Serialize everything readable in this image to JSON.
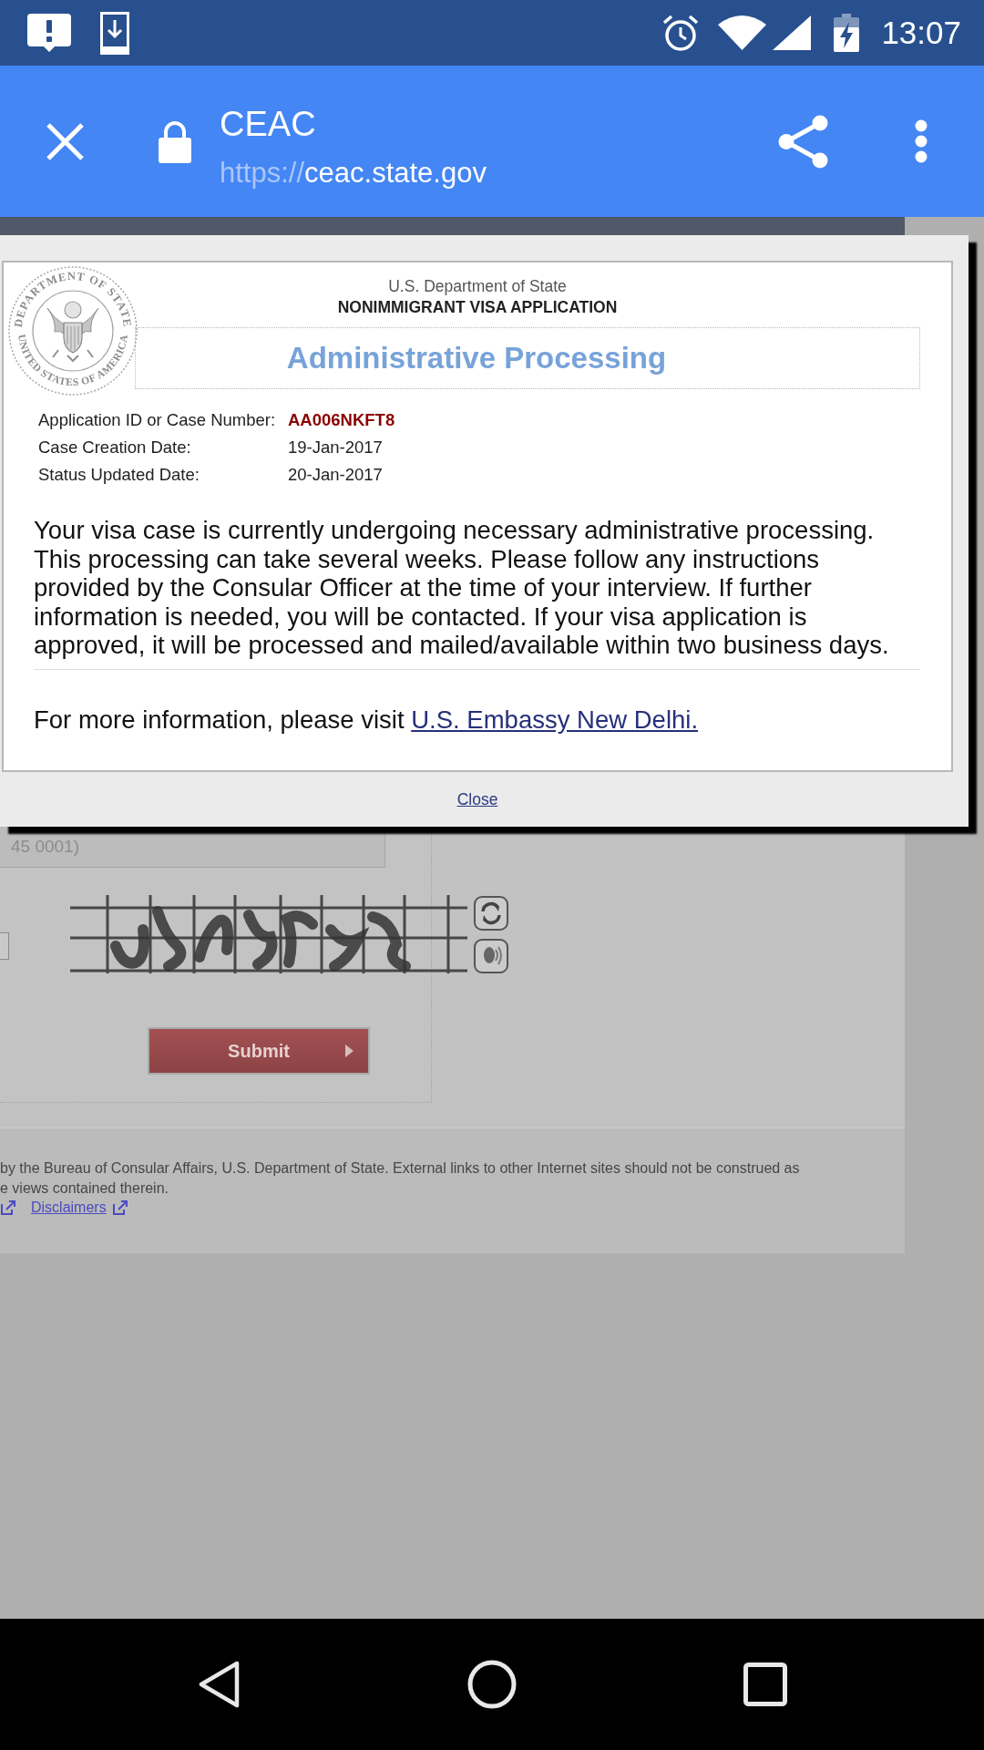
{
  "status_bar": {
    "time": "13:07"
  },
  "toolbar": {
    "title": "CEAC",
    "url": {
      "scheme": "https://",
      "host": "ceac.state.gov"
    }
  },
  "dialog": {
    "seal": {
      "top_text": "DEPARTMENT OF STATE",
      "bottom_text": "UNITED STATES OF AMERICA"
    },
    "department": "U.S. Department of State",
    "application_type": "NONIMMIGRANT VISA APPLICATION",
    "status_title": "Administrative Processing",
    "details": [
      {
        "label": "Application ID or Case Number:",
        "value": "AA006NKFT8",
        "kind": "case_number"
      },
      {
        "label": "Case Creation Date:",
        "value": "19-Jan-2017",
        "kind": "date"
      },
      {
        "label": "Status Updated Date:",
        "value": "20-Jan-2017",
        "kind": "date"
      }
    ],
    "message": "Your visa case is currently undergoing necessary administrative processing. This processing can take several weeks. Please follow any instructions provided by the Consular Officer at the time of your interview. If further information is needed, you will be contacted. If your visa application is approved, it will be processed and mailed/available within two business days.",
    "more_info": {
      "text": "For more information, please visit",
      "link": "U.S. Embassy New Delhi."
    },
    "close_link": "Close"
  },
  "background_page": {
    "case_field": {
      "placeholder": "45 0001)"
    },
    "submit_button": "Submit",
    "footer_lines": [
      "by the Bureau of Consular Affairs, U.S. Department of State. External links to other Internet sites should not be construed as",
      "e views contained therein."
    ],
    "footer_links": [
      "Disclaimers"
    ]
  }
}
